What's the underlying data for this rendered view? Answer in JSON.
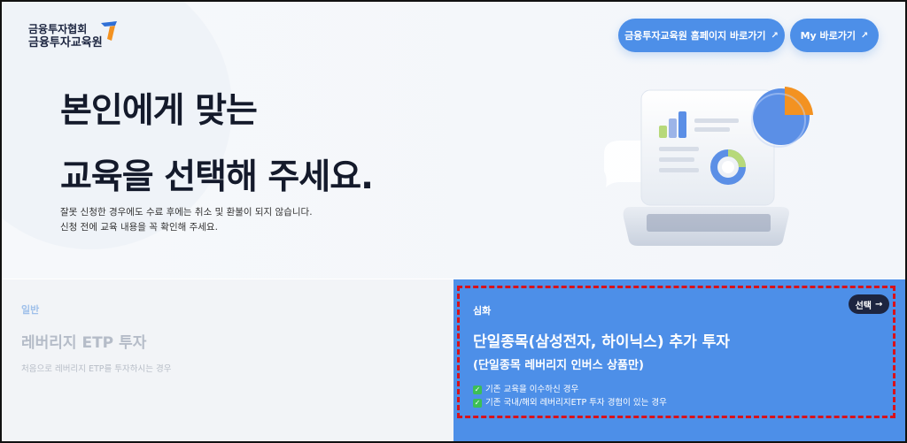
{
  "logo": {
    "line1": "금융투자협회",
    "line2": "금융투자교육원"
  },
  "header": {
    "btn_homepage": "금융투자교육원 홈페이지 바로가기",
    "btn_my": "My 바로가기",
    "arrow": "↗"
  },
  "hero": {
    "headline_line1": "본인에게 맞는",
    "headline_line2": "교육을 선택해 주세요.",
    "notice_line1": "잘못 신청한 경우에도 수료 후에는 취소 및 환불이 되지 않습니다.",
    "notice_line2": "신청 전에 교육 내용을 꼭 확인해 주세요."
  },
  "cards": {
    "basic": {
      "tag": "일반",
      "title": "레버리지 ETP 투자",
      "desc": "처음으로 레버리지 ETP를 투자하시는 경우"
    },
    "advanced": {
      "tag": "심화",
      "select_label": "선택",
      "select_arrow": "→",
      "title": "단일종목(삼성전자, 하이닉스) 추가 투자",
      "subtitle": "(단일종목 레버리지 인버스 상품만)",
      "conditions": [
        "기존 교육을 이수하신 경우",
        "기존 국내/해외 레버리지ETP 투자 경험이 있는 경우"
      ]
    }
  },
  "colors": {
    "accent": "#4d8fe8",
    "dark": "#1d2540",
    "highlight": "#d8121b"
  }
}
